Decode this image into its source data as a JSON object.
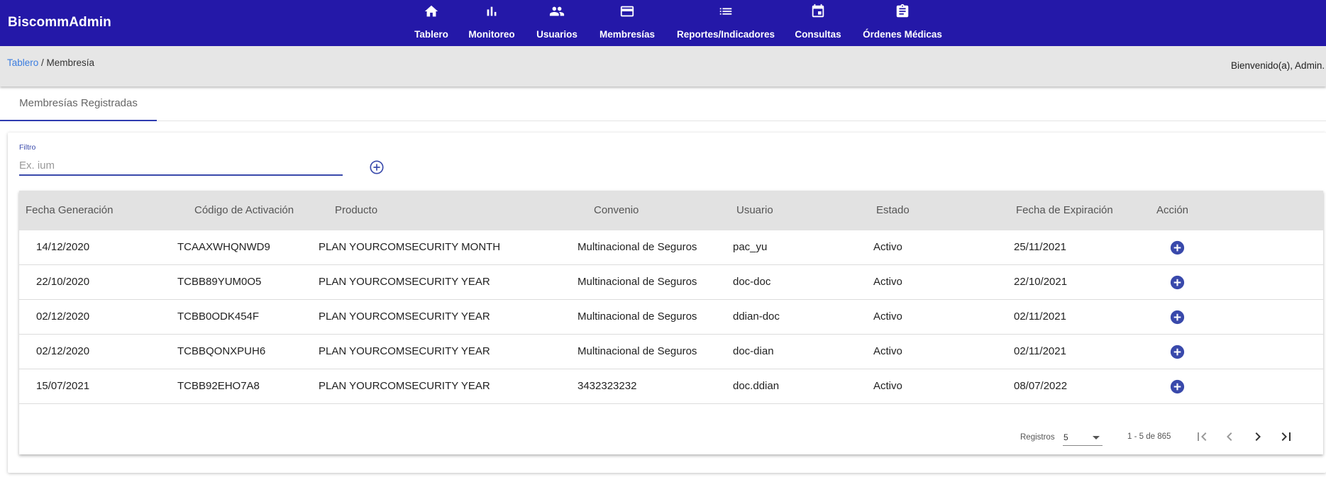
{
  "app": {
    "brand": "BiscommAdmin"
  },
  "nav": [
    {
      "label": "Tablero",
      "icon": "home-icon"
    },
    {
      "label": "Monitoreo",
      "icon": "bar-chart-icon"
    },
    {
      "label": "Usuarios",
      "icon": "people-icon"
    },
    {
      "label": "Membresías",
      "icon": "credit-card-icon"
    },
    {
      "label": "Reportes/Indicadores",
      "icon": "list-icon"
    },
    {
      "label": "Consultas",
      "icon": "calendar-icon"
    },
    {
      "label": "Órdenes Médicas",
      "icon": "clipboard-icon"
    }
  ],
  "breadcrumb": {
    "root": "Tablero",
    "separator": " / ",
    "current": "Membresía"
  },
  "welcome": "Bienvenido(a), Admin.",
  "tabs": [
    {
      "label": "Membresías Registradas",
      "active": true
    }
  ],
  "filter": {
    "label": "Filtro",
    "placeholder": "Ex. ium",
    "value": ""
  },
  "table": {
    "columns": [
      "Fecha Generación",
      "Código de Activación",
      "Producto",
      "Convenio",
      "Usuario",
      "Estado",
      "Fecha de Expiración",
      "Acción"
    ],
    "rows": [
      [
        "14/12/2020",
        "TCAAXWHQNWD9",
        "PLAN YOURCOMSECURITY MONTH",
        "Multinacional de Seguros",
        "pac_yu",
        "Activo",
        "25/11/2021"
      ],
      [
        "22/10/2020",
        "TCBB89YUM0O5",
        "PLAN YOURCOMSECURITY YEAR",
        "Multinacional de Seguros",
        "doc-doc",
        "Activo",
        "22/10/2021"
      ],
      [
        "02/12/2020",
        "TCBB0ODK454F",
        "PLAN YOURCOMSECURITY YEAR",
        "Multinacional de Seguros",
        "ddian-doc",
        "Activo",
        "02/11/2021"
      ],
      [
        "02/12/2020",
        "TCBBQONXPUH6",
        "PLAN YOURCOMSECURITY YEAR",
        "Multinacional de Seguros",
        "doc-dian",
        "Activo",
        "02/11/2021"
      ],
      [
        "15/07/2021",
        "TCBB92EHO7A8",
        "PLAN YOURCOMSECURITY YEAR",
        "3432323232",
        "doc.ddian",
        "Activo",
        "08/07/2022"
      ]
    ]
  },
  "paginator": {
    "label": "Registros",
    "page_size": "5",
    "range": "1 - 5 de 865"
  },
  "colors": {
    "primary": "#2418a8",
    "accent": "#3949ab",
    "link": "#3b7de0"
  }
}
